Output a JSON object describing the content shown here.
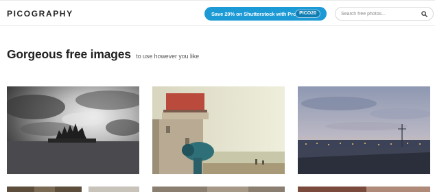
{
  "header": {
    "logo": "PICOGRAPHY",
    "promo": {
      "label": "Save 20% on Shutterstock with Promo Code",
      "code": "PICO20"
    },
    "search": {
      "placeholder": "Search free photos..."
    }
  },
  "hero": {
    "title": "Gorgeous free images",
    "subtitle": "to use however you like"
  },
  "colors": {
    "accent": "#1c9ad6",
    "text": "#222222"
  },
  "icons": {
    "search": "search-icon"
  }
}
